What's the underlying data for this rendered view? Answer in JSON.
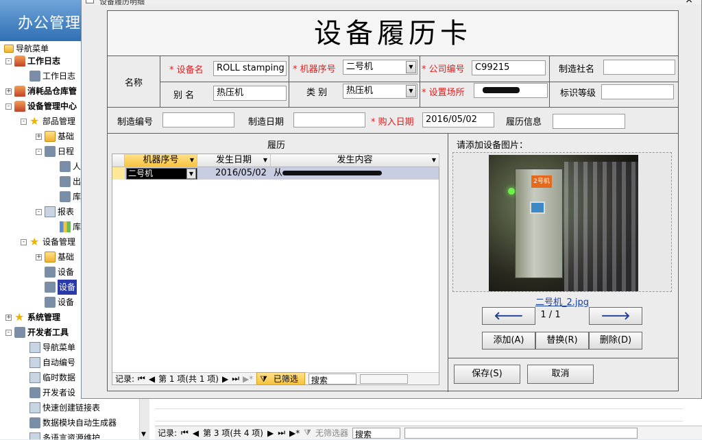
{
  "app": {
    "title": "办公管理"
  },
  "nav": {
    "header": "导航菜单",
    "items": [
      {
        "label": "工作日志",
        "indent": 0,
        "bold": true,
        "exp": "-",
        "icon": "home-icon"
      },
      {
        "label": "工作日志",
        "indent": 1,
        "bold": false,
        "exp": "",
        "icon": "tool-icon"
      },
      {
        "label": "消耗品仓库管",
        "indent": 0,
        "bold": true,
        "exp": "+",
        "icon": "home-icon"
      },
      {
        "label": "设备管理中心",
        "indent": 0,
        "bold": true,
        "exp": "-",
        "icon": "home-icon"
      },
      {
        "label": "部品管理",
        "indent": 1,
        "bold": false,
        "exp": "-",
        "icon": "star-icon"
      },
      {
        "label": "基础",
        "indent": 2,
        "bold": false,
        "exp": "+",
        "icon": "folder-icon"
      },
      {
        "label": "日程",
        "indent": 2,
        "bold": false,
        "exp": "-",
        "icon": "tool-icon"
      },
      {
        "label": "人",
        "indent": 3,
        "bold": false,
        "exp": "",
        "icon": "tool-icon"
      },
      {
        "label": "出",
        "indent": 3,
        "bold": false,
        "exp": "",
        "icon": "tool-icon"
      },
      {
        "label": "库",
        "indent": 3,
        "bold": false,
        "exp": "",
        "icon": "tool-icon"
      },
      {
        "label": "报表",
        "indent": 2,
        "bold": false,
        "exp": "-",
        "icon": "doc-icon"
      },
      {
        "label": "库",
        "indent": 3,
        "bold": false,
        "exp": "",
        "icon": "chart-icon"
      },
      {
        "label": "设备管理",
        "indent": 1,
        "bold": false,
        "exp": "-",
        "icon": "star-icon"
      },
      {
        "label": "基础",
        "indent": 2,
        "bold": false,
        "exp": "+",
        "icon": "folder-icon"
      },
      {
        "label": "设备",
        "indent": 2,
        "bold": false,
        "exp": "",
        "icon": "tool-icon"
      },
      {
        "label": "设备",
        "indent": 2,
        "bold": false,
        "exp": "",
        "icon": "tool-icon",
        "selected": true
      },
      {
        "label": "设备",
        "indent": 2,
        "bold": false,
        "exp": "",
        "icon": "tool-icon"
      },
      {
        "label": "系统管理",
        "indent": 0,
        "bold": true,
        "exp": "+",
        "icon": "star-icon"
      },
      {
        "label": "开发者工具",
        "indent": 0,
        "bold": true,
        "exp": "-",
        "icon": "tool-icon"
      },
      {
        "label": "导航菜单",
        "indent": 1,
        "bold": false,
        "exp": "",
        "icon": "doc-icon"
      },
      {
        "label": "自动编号",
        "indent": 1,
        "bold": false,
        "exp": "",
        "icon": "doc-icon"
      },
      {
        "label": "临时数据",
        "indent": 1,
        "bold": false,
        "exp": "",
        "icon": "doc-icon"
      },
      {
        "label": "开发者设",
        "indent": 1,
        "bold": false,
        "exp": "",
        "icon": "tool-icon"
      },
      {
        "label": "快速创建链接表",
        "indent": 1,
        "bold": false,
        "exp": "",
        "icon": "doc-icon"
      },
      {
        "label": "数据模块自动生成器",
        "indent": 1,
        "bold": false,
        "exp": "",
        "icon": "tool-icon"
      },
      {
        "label": "多语言资源维护",
        "indent": 1,
        "bold": false,
        "exp": "",
        "icon": "doc-icon"
      }
    ]
  },
  "bg_status": {
    "record_label": "记录:",
    "position": "第 3 项(共 4 项)",
    "filter": "无筛选器",
    "search": "搜索"
  },
  "dialog": {
    "title": "设备履历明细",
    "form_title": "设备履历卡",
    "labels": {
      "name_group": "名称",
      "equip_name": "* 设备名",
      "alias": "别  名",
      "machine_no": "* 机器序号",
      "category": "类 别",
      "company_no": "* 公司编号",
      "location": "* 设置场所",
      "maker": "制造社名",
      "id_level": "标识等级",
      "serial_no": "制造编号",
      "make_date": "制造日期",
      "buy_date": "* 购入日期",
      "history_info": "履历信息"
    },
    "values": {
      "equip_name": "ROLL stamping",
      "alias": "热压机",
      "machine_no": "二号机",
      "category": "热压机",
      "company_no": "C99215",
      "maker": "",
      "id_level": "",
      "serial_no": "",
      "make_date": "",
      "buy_date": "2016/05/02",
      "history_info": ""
    },
    "history": {
      "title": "履历",
      "columns": [
        "机器序号",
        "发生日期",
        "发生内容"
      ],
      "rows": [
        {
          "machine": "二号机",
          "date": "2016/05/02",
          "content": "从"
        }
      ],
      "nav": {
        "record_label": "记录:",
        "position": "第 1 项(共 1 项)",
        "filter": "已筛选",
        "search": "搜索"
      }
    },
    "photo": {
      "prompt": "请添加设备图片：",
      "sign_text": "2号机",
      "filename": "二号机_2.jpg",
      "page": "1 / 1",
      "add": "添加(A)",
      "replace": "替换(R)",
      "delete": "删除(D)"
    },
    "buttons": {
      "save": "保存(S)",
      "cancel": "取消"
    }
  }
}
